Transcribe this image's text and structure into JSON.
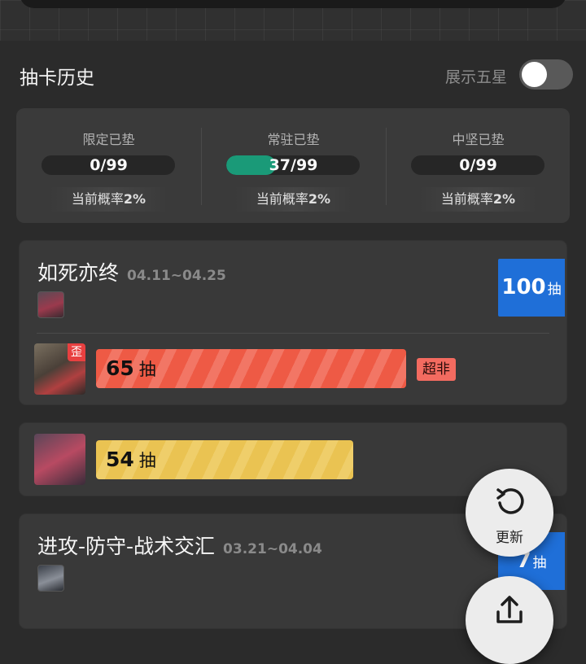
{
  "header": {
    "title": "抽卡历史",
    "toggle_label": "展示五星",
    "toggle_on": false
  },
  "stats": [
    {
      "label": "限定已垫",
      "value": "0/99",
      "progress": 0.0,
      "rate_prefix": "当前概率",
      "rate_value": "2%"
    },
    {
      "label": "常驻已垫",
      "value": "37/99",
      "progress": 0.37,
      "rate_prefix": "当前概率",
      "rate_value": "2%"
    },
    {
      "label": "中坚已垫",
      "value": "0/99",
      "progress": 0.0,
      "rate_prefix": "当前概率",
      "rate_value": "2%"
    }
  ],
  "banners": [
    {
      "title": "如死亦终",
      "date": "04.11~04.25",
      "count": "100",
      "count_unit": "抽",
      "pulls": [
        {
          "count": "65",
          "unit": "抽",
          "badge": "歪",
          "tag": "超非",
          "bar_color": "red",
          "fill": 0.65
        }
      ]
    },
    {
      "pulls": [
        {
          "count": "54",
          "unit": "抽",
          "bar_color": "yellow",
          "fill": 0.54
        }
      ]
    },
    {
      "title": "进攻-防守-战术交汇",
      "date": "03.21~04.04",
      "count": "7",
      "count_unit": "抽"
    }
  ],
  "fab": {
    "refresh_label": "更新"
  },
  "colors": {
    "background": "#2b2b2b",
    "card": "#393939",
    "accent_green": "#1a9a78",
    "count_tag_blue": "#1f6fd8",
    "bar_red": "#ee5a45",
    "bar_yellow": "#eac352",
    "badge_red": "#e84040"
  }
}
